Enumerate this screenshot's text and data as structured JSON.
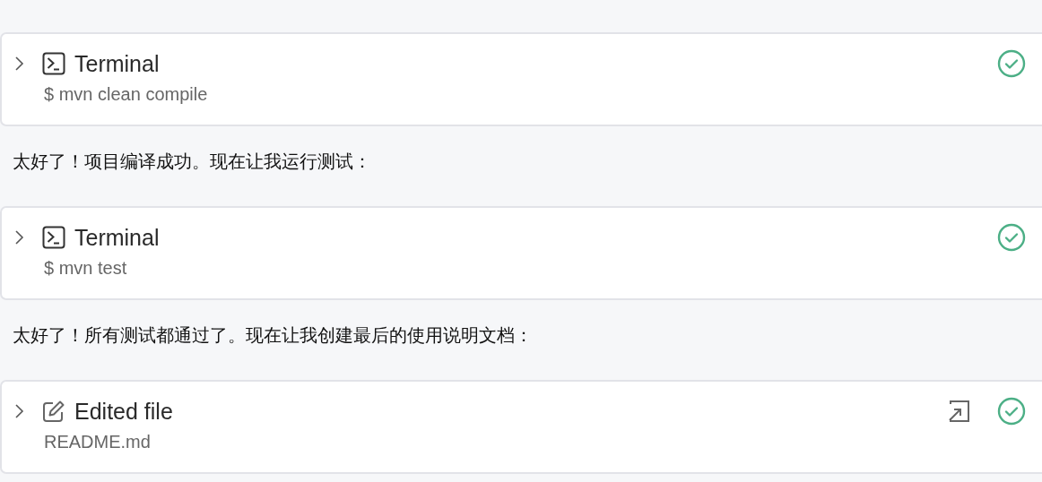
{
  "items": [
    {
      "kind": "terminal",
      "title": "Terminal",
      "detail": "$ mvn clean compile",
      "expanded": false,
      "done": true,
      "open_button": false
    },
    {
      "kind": "message",
      "text": "太好了！项目编译成功。现在让我运行测试："
    },
    {
      "kind": "terminal",
      "title": "Terminal",
      "detail": "$ mvn test",
      "expanded": false,
      "done": true,
      "open_button": false
    },
    {
      "kind": "message",
      "text": "太好了！所有测试都通过了。现在让我创建最后的使用说明文档："
    },
    {
      "kind": "edit",
      "title": "Edited file",
      "detail": "README.md",
      "expanded": false,
      "done": true,
      "open_button": true
    }
  ]
}
